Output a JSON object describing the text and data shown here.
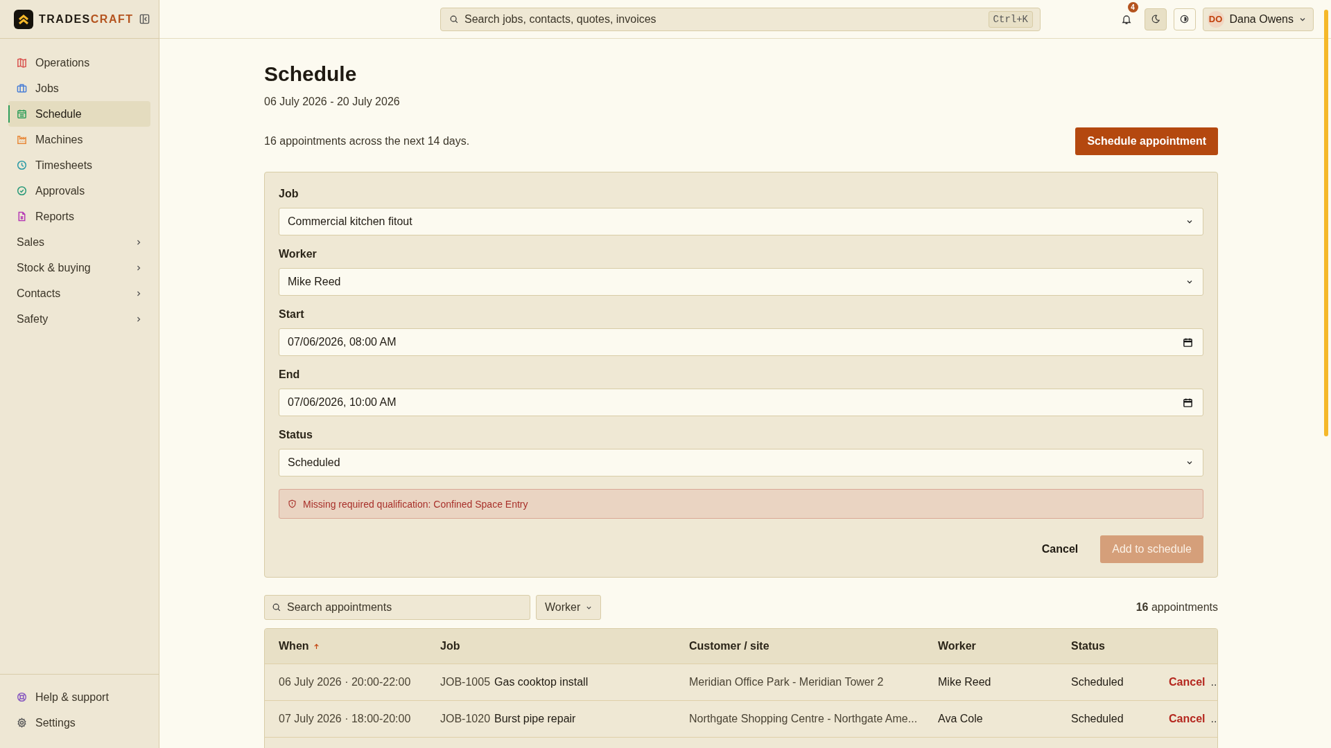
{
  "brand": {
    "primary": "TRADES",
    "accent": "CRAFT"
  },
  "sidebar": {
    "items": [
      {
        "label": "Operations",
        "kind": "map",
        "color": "#d9534f",
        "selected": false
      },
      {
        "label": "Jobs",
        "kind": "briefcase",
        "color": "#4a7fd6",
        "selected": false
      },
      {
        "label": "Schedule",
        "kind": "calendar",
        "color": "#2f9e5b",
        "selected": true
      },
      {
        "label": "Machines",
        "kind": "factory",
        "color": "#e8893a",
        "selected": false
      },
      {
        "label": "Timesheets",
        "kind": "clock",
        "color": "#2a9aa6",
        "selected": false
      },
      {
        "label": "Approvals",
        "kind": "check",
        "color": "#2a9a7a",
        "selected": false
      },
      {
        "label": "Reports",
        "kind": "file",
        "color": "#b53bb5",
        "selected": false
      },
      {
        "label": "Sales",
        "kind": "group",
        "selected": false
      },
      {
        "label": "Stock & buying",
        "kind": "group",
        "selected": false
      },
      {
        "label": "Contacts",
        "kind": "group",
        "selected": false
      },
      {
        "label": "Safety",
        "kind": "group",
        "selected": false
      }
    ],
    "footer": [
      {
        "label": "Help & support",
        "kind": "lifebuoy",
        "color": "#8a5cc0"
      },
      {
        "label": "Settings",
        "kind": "gear",
        "color": "#5a5a5a"
      }
    ]
  },
  "topbar": {
    "search": {
      "placeholder": "Search jobs, contacts, quotes, invoices",
      "shortcut": "Ctrl+K"
    },
    "notifications": "4",
    "user": {
      "initials": "DO",
      "name": "Dana Owens"
    }
  },
  "page": {
    "title": "Schedule",
    "date_range": "06 July 2026 - 20 July 2026",
    "summary": "16 appointments across the next 14 days.",
    "primary_button": "Schedule appointment"
  },
  "form": {
    "fields": [
      {
        "label": "Job",
        "kind": "select",
        "value": "Commercial kitchen fitout"
      },
      {
        "label": "Worker",
        "kind": "select",
        "value": "Mike Reed"
      },
      {
        "label": "Start",
        "kind": "datetime",
        "value": "07/06/2026, 08:00 AM"
      },
      {
        "label": "End",
        "kind": "datetime",
        "value": "07/06/2026, 10:00 AM"
      },
      {
        "label": "Status",
        "kind": "select",
        "value": "Scheduled"
      }
    ],
    "alert": "Missing required qualification: Confined Space Entry",
    "cancel": "Cancel",
    "submit": {
      "label": "Add to schedule",
      "disabled": true
    }
  },
  "toolbar": {
    "search_placeholder": "Search appointments",
    "filter": "Worker",
    "count": "**16** appointments"
  },
  "table": {
    "columns": [
      {
        "label": "When",
        "sorted": true
      },
      {
        "label": "Job",
        "sorted": false
      },
      {
        "label": "Customer / site",
        "sorted": false
      },
      {
        "label": "Worker",
        "sorted": false
      },
      {
        "label": "Status",
        "sorted": false
      }
    ],
    "rows": [
      {
        "when": "06 July 2026 · 20:00-22:00",
        "job_id": "JOB-1005",
        "job_title": "Gas cooktop install",
        "customer": "Meridian Office Park - Meridian Tower 2",
        "worker": "Mike Reed",
        "status": "Scheduled",
        "action": "Cancel",
        "more": ".."
      },
      {
        "when": "07 July 2026 · 18:00-20:00",
        "job_id": "JOB-1020",
        "job_title": "Burst pipe repair",
        "customer": "Northgate Shopping Centre - Northgate Ame...",
        "worker": "Ava Cole",
        "status": "Scheduled",
        "action": "Cancel",
        "more": ".."
      }
    ]
  }
}
